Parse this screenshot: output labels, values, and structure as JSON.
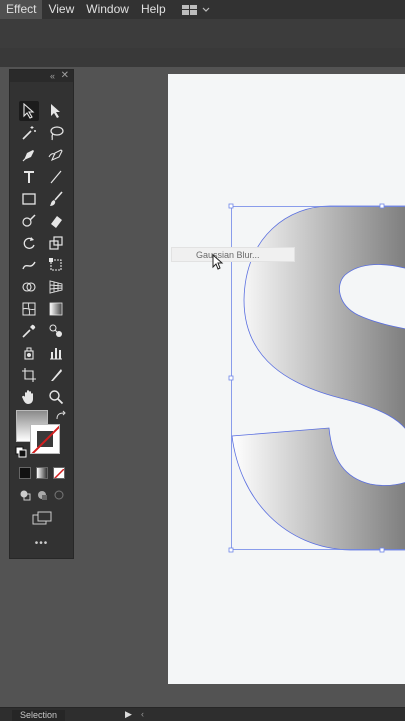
{
  "menubar": {
    "items": [
      "Effect",
      "View",
      "Window",
      "Help"
    ]
  },
  "canvas": {
    "artwork_letter": "S",
    "dropdown_item": "Gaussian Blur..."
  },
  "status": {
    "tool_name": "Selection"
  },
  "toolbar": {
    "more_label": "•••"
  },
  "colors": {
    "accent": "#4b5fd6",
    "fill_gradient_start": "#ffffff",
    "fill_gradient_end": "#7a7a7a"
  }
}
